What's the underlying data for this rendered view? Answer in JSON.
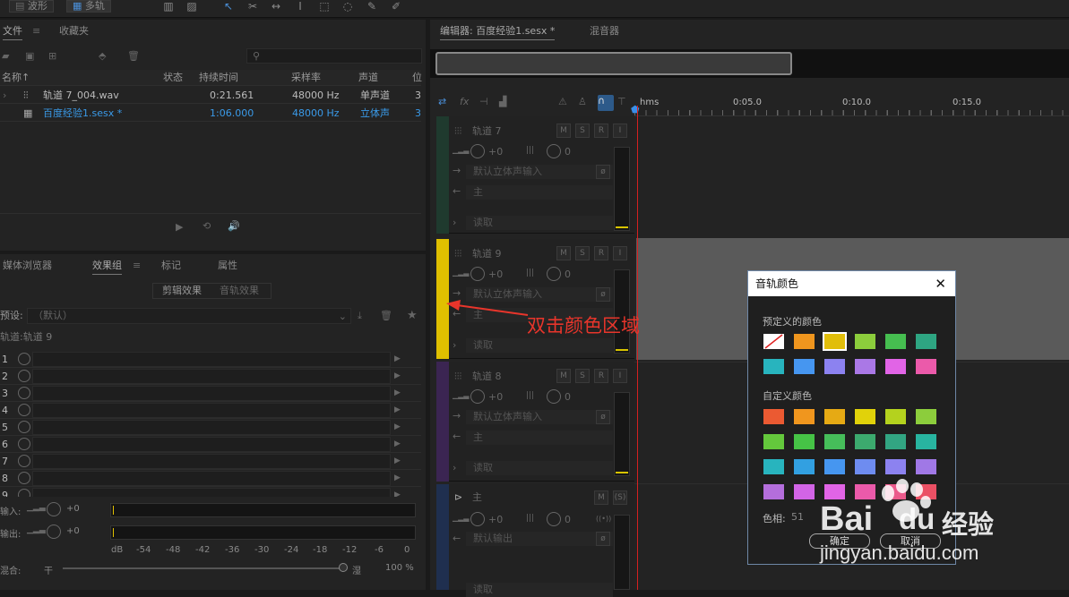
{
  "toolbar": {
    "waveform_label": "波形",
    "multitrack_label": "多轨"
  },
  "files_panel": {
    "tabs": [
      "文件",
      "收藏夹"
    ],
    "columns": [
      "名称↑",
      "状态",
      "持续时间",
      "采样率",
      "声道",
      "位"
    ],
    "rows": [
      {
        "name": "轨道 7_004.wav",
        "status": "",
        "duration": "0:21.561",
        "rate": "48000 Hz",
        "channels": "单声道",
        "bit": "3"
      },
      {
        "name": "百度经验1.sesx *",
        "status": "",
        "duration": "1:06.000",
        "rate": "48000 Hz",
        "channels": "立体声",
        "bit": "3"
      }
    ]
  },
  "effects_panel": {
    "tabs": [
      "媒体浏览器",
      "效果组",
      "标记",
      "属性"
    ],
    "subtabs": [
      "剪辑效果",
      "音轨效果"
    ],
    "preset_label": "预设:",
    "preset_value": "（默认）",
    "track_label": "轨道:轨道 9",
    "slots": [
      "1",
      "2",
      "3",
      "4",
      "5",
      "6",
      "7",
      "8",
      "9"
    ],
    "input_label": "输入:",
    "output_label": "输出:",
    "input_value": "+0",
    "output_value": "+0",
    "db_scale": [
      "dB",
      "-54",
      "-48",
      "-42",
      "-36",
      "-30",
      "-24",
      "-18",
      "-12",
      "-6",
      "0"
    ],
    "mix_label": "混合:",
    "dry_label": "干",
    "wet_label": "湿",
    "mix_value": "100 %"
  },
  "editor": {
    "tabs": [
      "编辑器: 百度经验1.sesx *",
      "混音器"
    ],
    "time_labels": [
      "hms",
      "0:05.0",
      "0:10.0",
      "0:15.0"
    ]
  },
  "tracks": [
    {
      "name": "轨道 7",
      "vol": "+0",
      "pan": "0",
      "input": "默认立体声输入",
      "output": "主",
      "mode": "读取",
      "color": "#1f3a2e",
      "btns": [
        "M",
        "S",
        "R",
        "I"
      ]
    },
    {
      "name": "轨道 9",
      "vol": "+0",
      "pan": "0",
      "input": "默认立体声输入",
      "output": "主",
      "mode": "读取",
      "color": "#e0c000",
      "btns": [
        "M",
        "S",
        "R",
        "I"
      ]
    },
    {
      "name": "轨道 8",
      "vol": "+0",
      "pan": "0",
      "input": "默认立体声输入",
      "output": "主",
      "mode": "读取",
      "color": "#3b2552",
      "btns": [
        "M",
        "S",
        "R",
        "I"
      ]
    },
    {
      "name": "主",
      "vol": "+0",
      "pan": "0",
      "input": "默认输出",
      "output": "",
      "mode": "读取",
      "color": "#1f2f4f",
      "btns": [
        "M",
        "(S)"
      ]
    }
  ],
  "annotation": {
    "text": "双击颜色区域",
    "color": "#e8352b"
  },
  "dialog": {
    "title": "音轨颜色",
    "predefined_label": "预定义的颜色",
    "custom_label": "自定义颜色",
    "hue_label": "色相:",
    "hue_value": "51",
    "ok_label": "确定",
    "cancel_label": "取消",
    "predefined_colors": [
      "none",
      "#f0961e",
      "#e1be0a",
      "#8ccd3c",
      "#46be50",
      "#2ea582",
      "#28b4be",
      "#4696f0",
      "#8c82f0",
      "#aa78e6",
      "#e164e6",
      "#eb5aaa"
    ],
    "custom_colors": [
      "#eb5a32",
      "#f0961e",
      "#e6aa14",
      "#e1d20a",
      "#b4d21e",
      "#8ccd3c",
      "#64c83c",
      "#46c346",
      "#46be5a",
      "#3caa6e",
      "#32a582",
      "#28b4a0",
      "#28b4be",
      "#32a0e1",
      "#4696f0",
      "#6e8cf0",
      "#8c82f0",
      "#a078e6",
      "#b46edc",
      "#d264e6",
      "#e164e6",
      "#eb5aaa",
      "#eb5a8c",
      "#eb5064"
    ],
    "selected_index": 2
  },
  "watermark": {
    "brand": "Bai",
    "brand2": "du",
    "suffix": "经验",
    "url": "jingyan.baidu.com"
  }
}
